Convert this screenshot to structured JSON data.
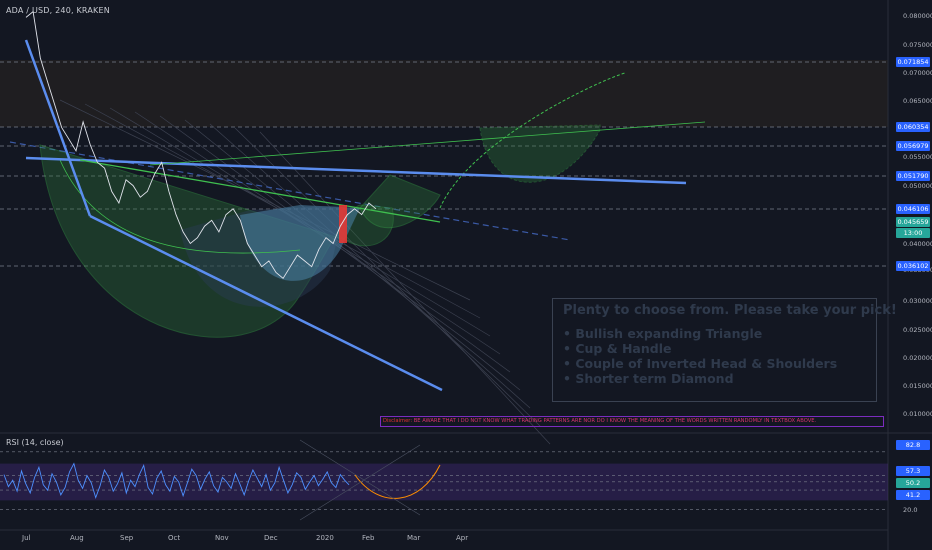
{
  "header": {
    "symbol": "ADA / USD, 240, KRAKEN"
  },
  "rsi": {
    "title": "RSI (14, close)"
  },
  "annotation": {
    "heading": "Plenty to choose from. Please take your pick!",
    "items": [
      "Bullish expanding Triangle",
      "Cup & Handle",
      "Couple of Inverted Head & Shoulders",
      "Shorter term Diamond"
    ]
  },
  "disclaimer": {
    "label": "Disclaimer:",
    "text": " BE AWARE THAT I DO NOT KNOW WHAT TRADING PATTERNS ARE NOR DO I KNOW THE MEANING OF THE WORDS WRITTEN RANDOMLY IN TEXTBOX ABOVE."
  },
  "price_axis": {
    "ticks": [
      "0.080000",
      "0.075000",
      "0.070000",
      "0.065000",
      "0.055000",
      "0.050000",
      "0.040000",
      "0.035000",
      "0.030000",
      "0.025000",
      "0.020000",
      "0.015000",
      "0.010000"
    ],
    "labels": [
      {
        "text": "0.071854",
        "color": "#2962ff"
      },
      {
        "text": "0.060354",
        "color": "#2962ff"
      },
      {
        "text": "0.056979",
        "color": "#2962ff"
      },
      {
        "text": "0.051790",
        "color": "#2962ff"
      },
      {
        "text": "0.046106",
        "color": "#2962ff"
      },
      {
        "text": "0.045659",
        "color": "#26a69a"
      },
      {
        "text": "13:00",
        "color": "#26a69a"
      },
      {
        "text": "0.036102",
        "color": "#2962ff"
      }
    ]
  },
  "rsi_axis": {
    "ticks": [
      "20.0"
    ],
    "labels": [
      {
        "text": "82.8",
        "color": "#2962ff"
      },
      {
        "text": "57.3",
        "color": "#2962ff"
      },
      {
        "text": "50.2",
        "color": "#26a69a"
      },
      {
        "text": "41.2",
        "color": "#2962ff"
      }
    ]
  },
  "chart_data": {
    "type": "line",
    "title": "ADA / USD, 240, KRAKEN",
    "x_ticks": [
      "Jul",
      "Aug",
      "Sep",
      "Oct",
      "Nov",
      "Dec",
      "2020",
      "Feb",
      "Mar",
      "Apr"
    ],
    "ylim": [
      0.0075,
      0.082
    ],
    "series": [
      {
        "name": "ADA / USD",
        "points": [
          [
            0,
            0.079
          ],
          [
            1,
            0.08
          ],
          [
            2,
            0.072
          ],
          [
            3,
            0.068
          ],
          [
            4,
            0.064
          ],
          [
            5,
            0.06
          ],
          [
            6,
            0.058
          ],
          [
            7,
            0.056
          ],
          [
            8,
            0.061
          ],
          [
            9,
            0.057
          ],
          [
            10,
            0.054
          ],
          [
            11,
            0.053
          ],
          [
            12,
            0.049
          ],
          [
            13,
            0.047
          ],
          [
            14,
            0.051
          ],
          [
            15,
            0.05
          ],
          [
            16,
            0.048
          ],
          [
            17,
            0.049
          ],
          [
            18,
            0.052
          ],
          [
            19,
            0.054
          ],
          [
            20,
            0.049
          ],
          [
            21,
            0.045
          ],
          [
            22,
            0.042
          ],
          [
            23,
            0.04
          ],
          [
            24,
            0.041
          ],
          [
            25,
            0.043
          ],
          [
            26,
            0.044
          ],
          [
            27,
            0.042
          ],
          [
            28,
            0.045
          ],
          [
            29,
            0.046
          ],
          [
            30,
            0.044
          ],
          [
            31,
            0.04
          ],
          [
            32,
            0.038
          ],
          [
            33,
            0.036
          ],
          [
            34,
            0.037
          ],
          [
            35,
            0.035
          ],
          [
            36,
            0.034
          ],
          [
            37,
            0.036
          ],
          [
            38,
            0.038
          ],
          [
            39,
            0.037
          ],
          [
            40,
            0.036
          ],
          [
            41,
            0.039
          ],
          [
            42,
            0.041
          ],
          [
            43,
            0.04
          ],
          [
            44,
            0.043
          ],
          [
            45,
            0.045
          ],
          [
            46,
            0.046
          ],
          [
            47,
            0.045
          ],
          [
            48,
            0.047
          ],
          [
            49,
            0.046
          ]
        ]
      }
    ],
    "rsi": {
      "name": "RSI (14, close)",
      "ylim": [
        0,
        100
      ],
      "levels": [
        82.8,
        57.3,
        50.2,
        41.2,
        20.0
      ],
      "values": [
        58,
        45,
        52,
        40,
        62,
        48,
        38,
        55,
        66,
        47,
        41,
        59,
        50,
        36,
        44,
        61,
        70,
        52,
        43,
        57,
        49,
        33,
        46,
        63,
        55,
        40,
        48,
        60,
        38,
        52,
        45,
        58,
        68,
        44,
        37,
        54,
        62,
        47,
        40,
        56,
        50,
        35,
        49,
        64,
        57,
        42,
        53,
        61,
        46,
        39,
        55,
        50,
        43,
        59,
        48,
        36,
        51,
        63,
        54,
        45,
        58,
        41,
        49,
        66,
        52,
        38,
        47,
        60,
        55,
        42,
        50,
        57,
        46,
        53,
        61,
        49,
        44,
        58,
        52,
        47
      ]
    }
  }
}
